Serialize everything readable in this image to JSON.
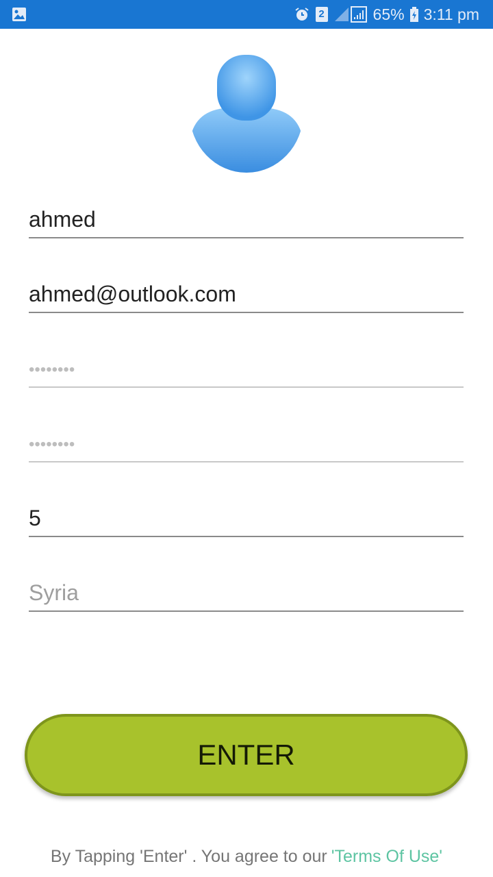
{
  "status_bar": {
    "battery": "65%",
    "time": "3:11 pm",
    "sim_badge": "2",
    "icons": [
      "image-icon",
      "alarm-icon",
      "sim-icon",
      "signal-icon",
      "battery-charging-icon"
    ]
  },
  "avatar": {
    "icon": "user-avatar-icon"
  },
  "form": {
    "name": {
      "value": "ahmed"
    },
    "email": {
      "value": "ahmed@outlook.com"
    },
    "password": {
      "placeholder": "••••••••"
    },
    "confirm_password": {
      "placeholder": "••••••••"
    },
    "number": {
      "value": "5"
    },
    "country": {
      "placeholder": "Syria"
    }
  },
  "enter_button": {
    "label": "ENTER"
  },
  "footer": {
    "text": "By Tapping 'Enter' . You agree to our",
    "link": "'Terms Of Use'"
  },
  "colors": {
    "status_bar": "#1976d2",
    "button": "#a8c22c",
    "button_border": "#7e951c",
    "link": "#5dc4a2"
  }
}
